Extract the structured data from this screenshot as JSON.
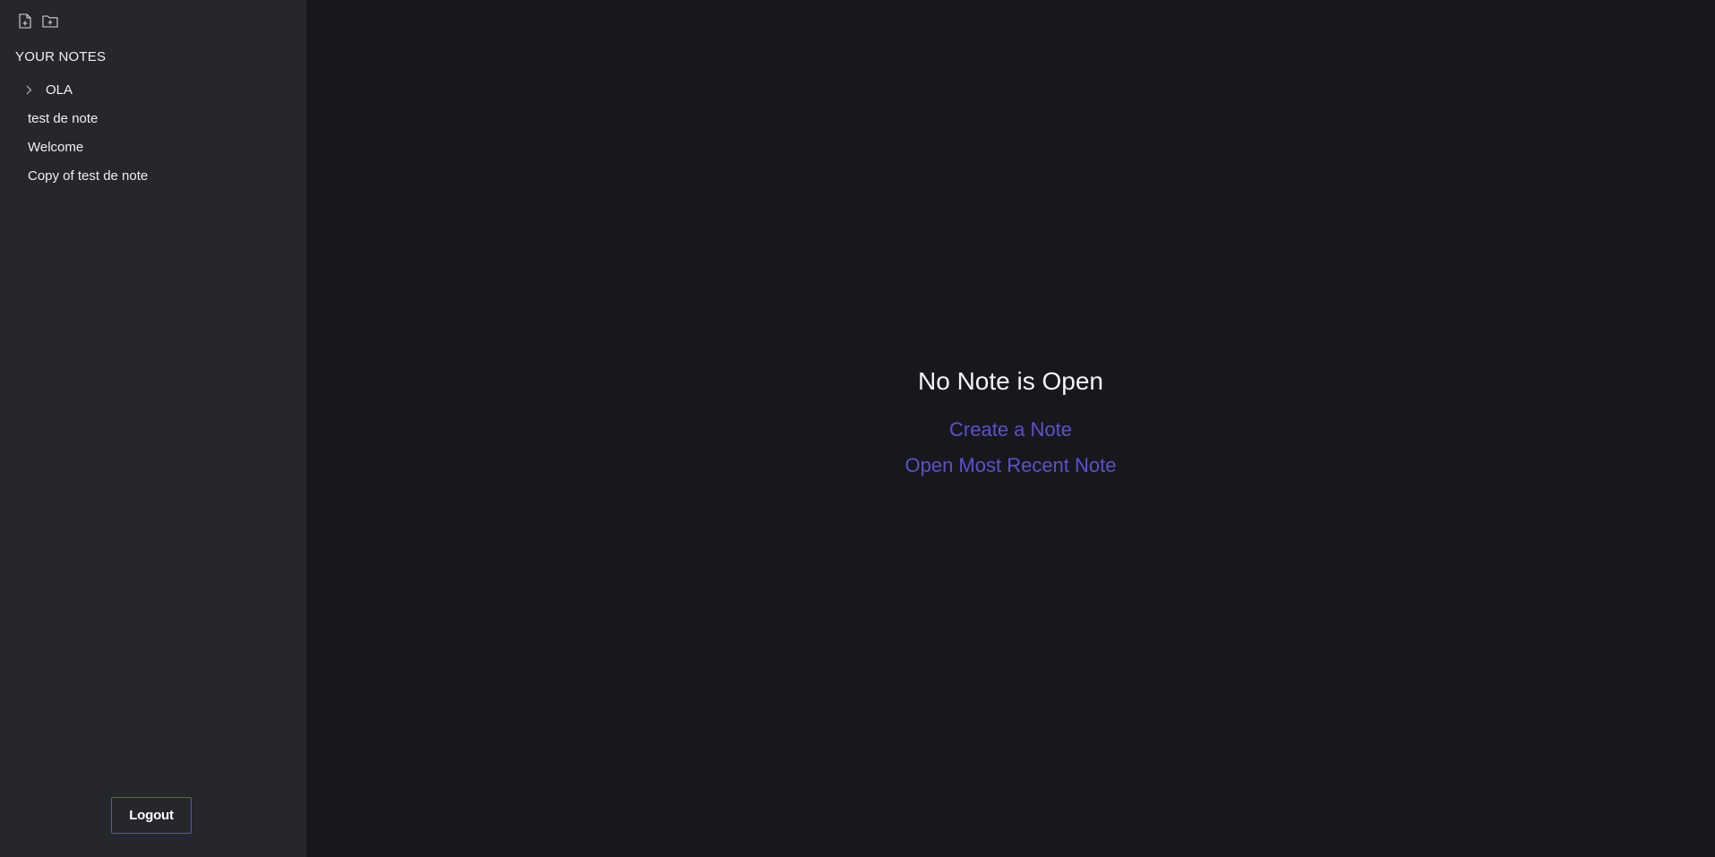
{
  "sidebar": {
    "toolbar": {
      "new_note_icon": "file-plus-icon",
      "new_folder_icon": "folder-plus-icon"
    },
    "section_title": "YOUR NOTES",
    "folders": [
      {
        "label": "OLA",
        "icon": "chevron-right-icon"
      }
    ],
    "notes": [
      {
        "label": "test de note"
      },
      {
        "label": "Welcome"
      },
      {
        "label": "Copy of test de note"
      }
    ],
    "logout_label": "Logout"
  },
  "main": {
    "empty_title": "No Note is Open",
    "create_link": "Create a Note",
    "open_recent_link": "Open Most Recent Note"
  },
  "colors": {
    "sidebar_bg": "#26272b",
    "main_bg": "#18181c",
    "accent": "#5b51cf"
  }
}
